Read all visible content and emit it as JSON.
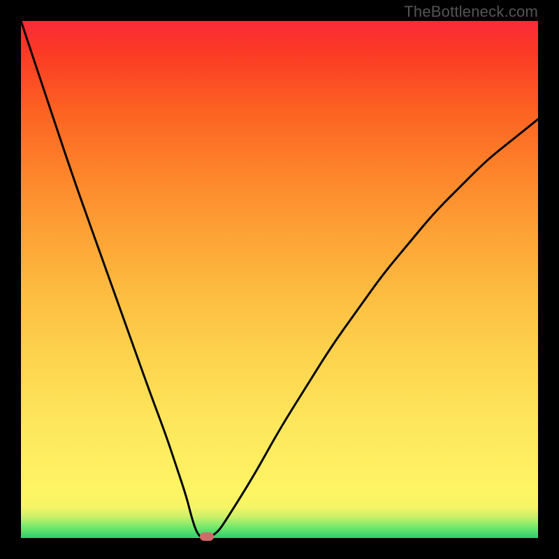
{
  "watermark": "TheBottleneck.com",
  "colors": {
    "frame": "#000000",
    "curve": "#000000",
    "marker": "#d36a6a",
    "gradient_stops": [
      {
        "pct": 0,
        "hex": "#2ecc71"
      },
      {
        "pct": 2,
        "hex": "#6ee86b"
      },
      {
        "pct": 4,
        "hex": "#c8f06a"
      },
      {
        "pct": 6,
        "hex": "#f6f565"
      },
      {
        "pct": 9,
        "hex": "#fef564"
      },
      {
        "pct": 22,
        "hex": "#fde75c"
      },
      {
        "pct": 46,
        "hex": "#fdbf42"
      },
      {
        "pct": 70,
        "hex": "#fd862b"
      },
      {
        "pct": 94,
        "hex": "#fb3a25"
      },
      {
        "pct": 100,
        "hex": "#fa2a3a"
      }
    ]
  },
  "chart_data": {
    "type": "line",
    "title": "",
    "xlabel": "",
    "ylabel": "",
    "xlim": [
      0,
      100
    ],
    "ylim": [
      0,
      100
    ],
    "series": [
      {
        "name": "bottleneck-curve",
        "x": [
          0,
          5,
          10,
          15,
          20,
          25,
          28,
          30,
          32,
          33,
          34,
          35,
          36,
          38,
          40,
          45,
          50,
          55,
          60,
          65,
          70,
          75,
          80,
          85,
          90,
          95,
          100
        ],
        "y": [
          100,
          85,
          70,
          56,
          42,
          28,
          20,
          14,
          8,
          4,
          1,
          0,
          0,
          1,
          4,
          12,
          21,
          29,
          37,
          44,
          51,
          57,
          63,
          68,
          73,
          77,
          81
        ]
      }
    ],
    "marker": {
      "x": 36,
      "y": 0
    }
  }
}
